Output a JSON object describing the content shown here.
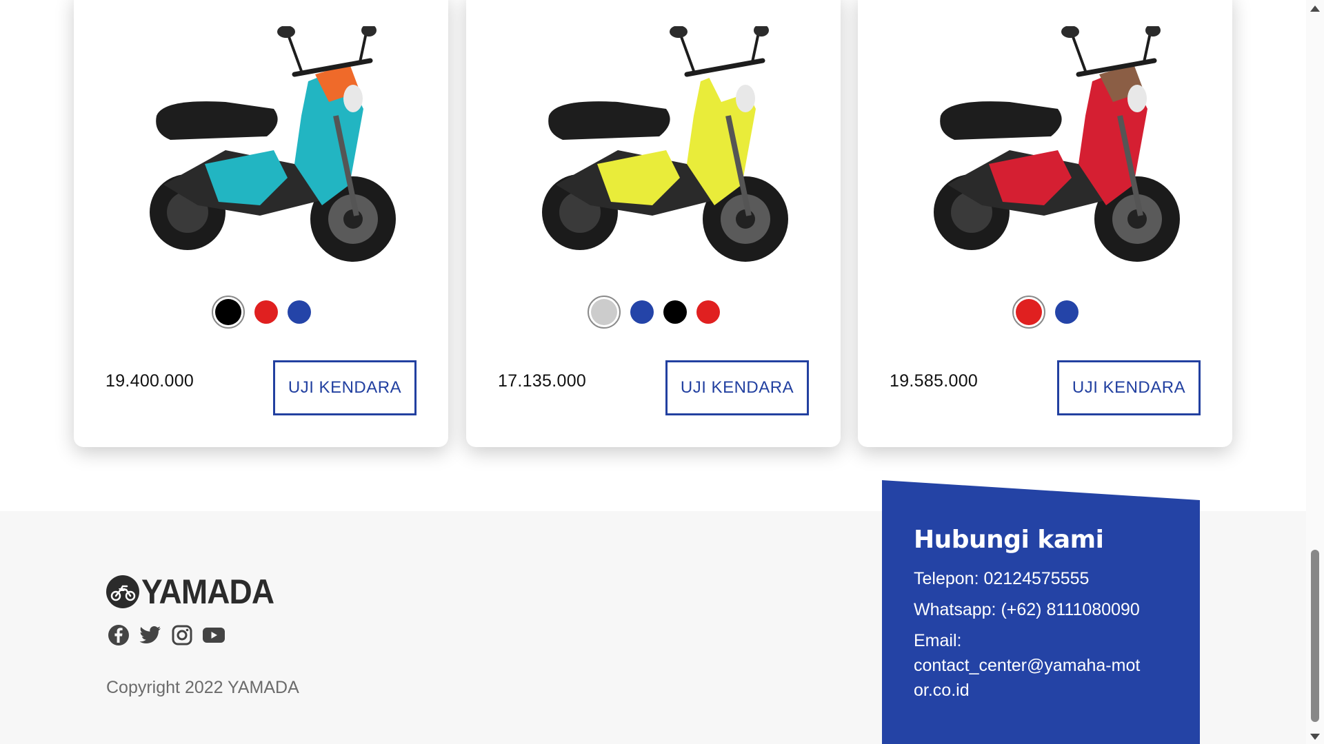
{
  "products": [
    {
      "name": "moto-1",
      "price": "19.400.000",
      "button_label": "UJI KENDARA",
      "colors": [
        "#000000",
        "#e02020",
        "#2444a8"
      ],
      "selected_color_index": 0,
      "body_color": "#22b5c2",
      "accent_color": "#ef6a2a"
    },
    {
      "name": "moto-2",
      "price": "17.135.000",
      "button_label": "UJI KENDARA",
      "colors": [
        "#cccccc",
        "#2444a8",
        "#000000",
        "#e02020"
      ],
      "selected_color_index": 0,
      "body_color": "#e9ec3a",
      "accent_color": "#ffffff"
    },
    {
      "name": "moto-3",
      "price": "19.585.000",
      "button_label": "UJI KENDARA",
      "colors": [
        "#e02020",
        "#2444a8"
      ],
      "selected_color_index": 0,
      "body_color": "#d51f32",
      "accent_color": "#8b5e45"
    }
  ],
  "footer": {
    "brand": "YAMADA",
    "copyright": "Copyright 2022 YAMADA",
    "socials": [
      "facebook-icon",
      "twitter-icon",
      "instagram-icon",
      "youtube-icon"
    ]
  },
  "contact": {
    "title": "Hubungi kami",
    "phone": "Telepon: 02124575555",
    "whatsapp": "Whatsapp: (+62) 8111080090",
    "email_label": "Email:",
    "email": "contact_center@yamaha-motor.co.id"
  },
  "theme": {
    "accent": "#2443a5",
    "footer_bg": "#f7f7f7"
  }
}
